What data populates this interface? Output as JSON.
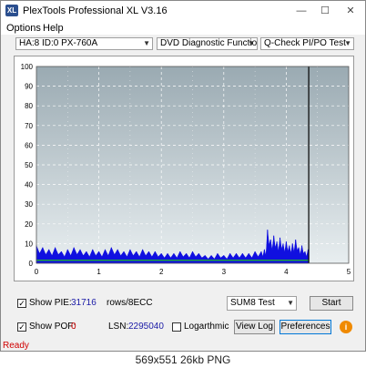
{
  "window": {
    "title": "PlexTools Professional XL V3.16",
    "app_icon_text": "XL",
    "minimize": "—",
    "maximize": "☐",
    "close": "✕"
  },
  "menu": {
    "options": "Options",
    "help": "Help"
  },
  "toolbar": {
    "drive": "HA:8 ID:0  PX-760A",
    "function": "DVD Diagnostic Functions",
    "test": "Q-Check PI/PO Test"
  },
  "chart_data": {
    "type": "area",
    "title": "",
    "xlabel": "",
    "ylabel": "",
    "xlim": [
      0,
      5
    ],
    "ylim": [
      0,
      100
    ],
    "x_ticks": [
      "0",
      "1",
      "2",
      "3",
      "4",
      "5"
    ],
    "y_ticks": [
      "100",
      "90",
      "80",
      "70",
      "60",
      "50",
      "40",
      "30",
      "20",
      "10",
      "0"
    ],
    "grid": true,
    "end_marker_x": 4.36,
    "series": [
      {
        "color": "#1010e0",
        "x": [
          0,
          0.1,
          0.2,
          0.3,
          0.4,
          0.5,
          0.6,
          0.7,
          0.8,
          0.9,
          1.0,
          1.1,
          1.2,
          1.3,
          1.4,
          1.5,
          1.6,
          1.7,
          1.8,
          1.9,
          2.0,
          2.1,
          2.2,
          2.3,
          2.4,
          2.5,
          2.6,
          2.7,
          2.8,
          2.9,
          3.0,
          3.1,
          3.2,
          3.3,
          3.4,
          3.5,
          3.6,
          3.65,
          3.7,
          3.75,
          3.8,
          3.85,
          3.9,
          3.95,
          4.0,
          4.05,
          4.1,
          4.15,
          4.2,
          4.25,
          4.3,
          4.35
        ],
        "values": [
          9,
          8,
          7,
          8,
          6,
          7,
          8,
          7,
          6,
          7,
          6,
          7,
          8,
          7,
          6,
          7,
          6,
          7,
          6,
          6,
          5,
          5,
          5,
          6,
          5,
          6,
          5,
          4,
          4,
          5,
          4,
          5,
          5,
          5,
          5,
          6,
          6,
          7,
          17,
          12,
          14,
          11,
          13,
          10,
          11,
          9,
          10,
          12,
          8,
          9,
          6,
          7
        ]
      },
      {
        "color": "#20c020",
        "x": [
          0,
          4.36
        ],
        "values": [
          1.5,
          1.5
        ]
      }
    ]
  },
  "controls": {
    "show_pie_label": "Show PIE:",
    "pie_value": "31716",
    "pie_unit": "rows/8ECC",
    "show_pof_label": "Show POF:",
    "pof_value": "0",
    "lsn_label": "LSN:",
    "lsn_value": "2295040",
    "logarithmic_label": "Logarthmic",
    "sum_select": "SUM8 Test",
    "start": "Start",
    "view_log": "View Log",
    "preferences": "Preferences",
    "help_icon": "i"
  },
  "status": "Ready",
  "caption": "569x551 26kb PNG"
}
